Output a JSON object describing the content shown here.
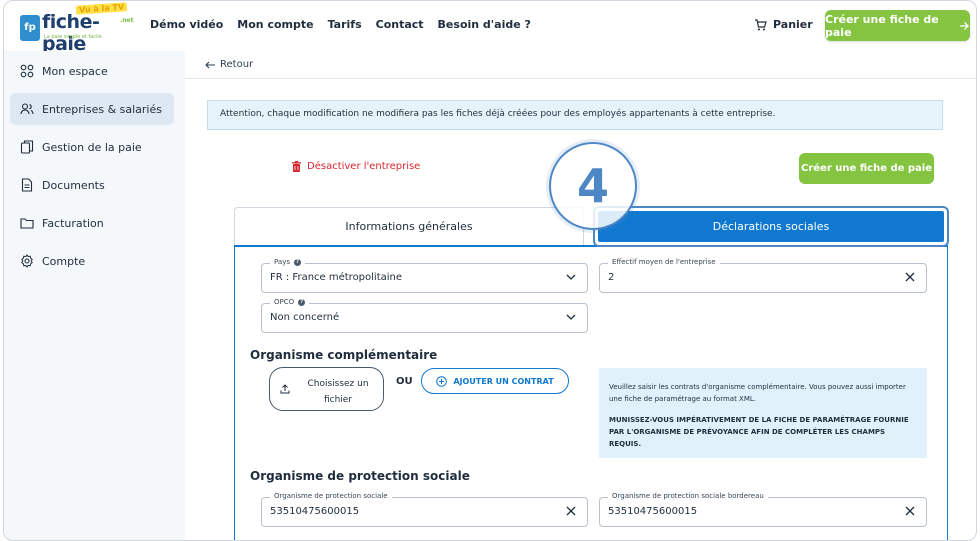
{
  "header": {
    "logo_text": "fiche-paie",
    "logo_badge": "fp",
    "logo_tv": "Vu à la TV",
    "logo_net": ".net",
    "logo_tagline": "La paie simple et facile",
    "nav": [
      "Démo vidéo",
      "Mon compte",
      "Tarifs",
      "Contact",
      "Besoin d'aide ?"
    ],
    "cart_label": "Panier",
    "cta_label": "Créer une fiche de paie"
  },
  "sidebar": {
    "items": [
      {
        "label": "Mon espace"
      },
      {
        "label": "Entreprises & salariés"
      },
      {
        "label": "Gestion de la paie"
      },
      {
        "label": "Documents"
      },
      {
        "label": "Facturation"
      },
      {
        "label": "Compte"
      }
    ]
  },
  "main": {
    "back_label": "Retour",
    "notice": "Attention, chaque modification ne modifiera pas les fiches déjà créées pour des employés appartenants à cette entreprise.",
    "deactivate_label": "Désactiver l'entreprise",
    "create_button": "Créer une fiche de paie",
    "step_number": "4",
    "tabs": {
      "general": "Informations générales",
      "social": "Déclarations sociales"
    },
    "fields": {
      "pays_label": "Pays",
      "pays_value": "FR : France métropolitaine",
      "effectif_label": "Effectif moyen de l'entreprise",
      "effectif_value": "2",
      "opco_label": "OPCO",
      "opco_value": "Non concerné"
    },
    "complementaire": {
      "title": "Organisme complémentaire",
      "upload_label": "Choisissez un fichier",
      "or": "OU",
      "add_contract": "AJOUTER UN CONTRAT",
      "info_text": "Veuillez saisir les contrats d'organisme complémentaire. Vous pouvez aussi importer une fiche de paramétrage au format XML.",
      "info_strong": "MUNISSEZ-VOUS IMPÉRATIVEMENT DE LA FICHE DE PARAMÉTRAGE FOURNIE PAR L'ORGANISME DE PRÉVOYANCE AFIN DE COMPLÉTER LES CHAMPS REQUIS."
    },
    "protection": {
      "title": "Organisme de protection sociale",
      "field1_label": "Organisme de protection sociale",
      "field1_value": "53510475600015",
      "field2_label": "Organisme de protection sociale bordereau",
      "field2_value": "53510475600015"
    }
  },
  "colors": {
    "green": "#84c441",
    "blue": "#1078cf",
    "red": "#d8262c",
    "step_ring": "#4e87c6"
  }
}
